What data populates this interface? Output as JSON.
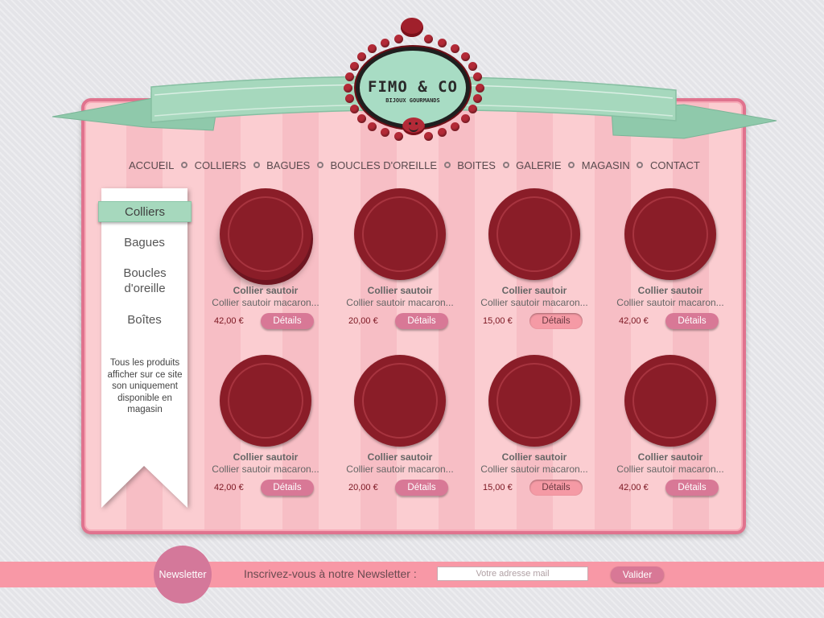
{
  "logo": {
    "title": "FIMO & CO",
    "subtitle": "BIJOUX GOURMANDS"
  },
  "nav": {
    "items": [
      "ACCUEIL",
      "COLLIERS",
      "BAGUES",
      "BOUCLES D'OREILLE",
      "BOITES",
      "GALERIE",
      "MAGASIN",
      "CONTACT"
    ]
  },
  "sidebar": {
    "items": [
      "Colliers",
      "Bagues",
      "Boucles d'oreille",
      "Boîtes"
    ],
    "active": "Colliers",
    "note": "Tous les produits afficher sur ce site son uniquement disponible en magasin"
  },
  "products": [
    {
      "title": "Collier sautoir",
      "desc": "Collier sautoir macaron...",
      "price": "42,00 €",
      "button": "Détails"
    },
    {
      "title": "Collier sautoir",
      "desc": "Collier sautoir macaron...",
      "price": "20,00 €",
      "button": "Détails"
    },
    {
      "title": "Collier sautoir",
      "desc": "Collier sautoir macaron...",
      "price": "15,00 €",
      "button": "Détails"
    },
    {
      "title": "Collier sautoir",
      "desc": "Collier sautoir macaron...",
      "price": "42,00 €",
      "button": "Détails"
    },
    {
      "title": "Collier sautoir",
      "desc": "Collier sautoir macaron...",
      "price": "42,00 €",
      "button": "Détails"
    },
    {
      "title": "Collier sautoir",
      "desc": "Collier sautoir macaron...",
      "price": "20,00 €",
      "button": "Détails"
    },
    {
      "title": "Collier sautoir",
      "desc": "Collier sautoir macaron...",
      "price": "15,00 €",
      "button": "Détails"
    },
    {
      "title": "Collier sautoir",
      "desc": "Collier sautoir macaron...",
      "price": "42,00 €",
      "button": "Détails"
    }
  ],
  "newsletter": {
    "badge": "Newsletter",
    "label": "Inscrivez-vous à notre Newsletter :",
    "placeholder": "Votre adresse mail",
    "submit": "Valider"
  },
  "colors": {
    "panel": "#fbcdd1",
    "ribbon": "#a6d8bd",
    "plate": "#8a1d28",
    "button": "#d87896",
    "footer": "#f898a6"
  }
}
